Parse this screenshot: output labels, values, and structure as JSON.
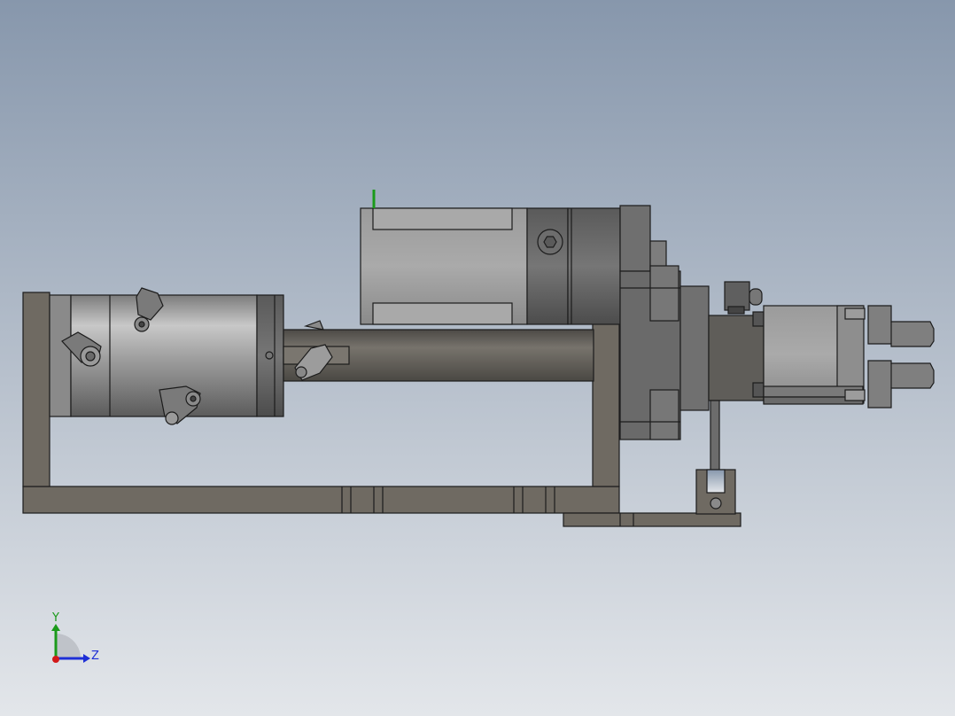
{
  "viewport": {
    "background_top": "#8797ac",
    "background_bottom": "#e3e6ea"
  },
  "triad": {
    "y_label": "Y",
    "z_label": "Z",
    "y_color": "#1a9a1a",
    "z_color": "#1e2fd6",
    "x_color": "#d21818"
  },
  "colors": {
    "frame": "#6f6a62",
    "frame_dark": "#3e3b36",
    "metal_light": "#b4b4b4",
    "metal_mid": "#8d8d8d",
    "metal_dark": "#4f4f4f",
    "edge": "#1c1c1c"
  }
}
